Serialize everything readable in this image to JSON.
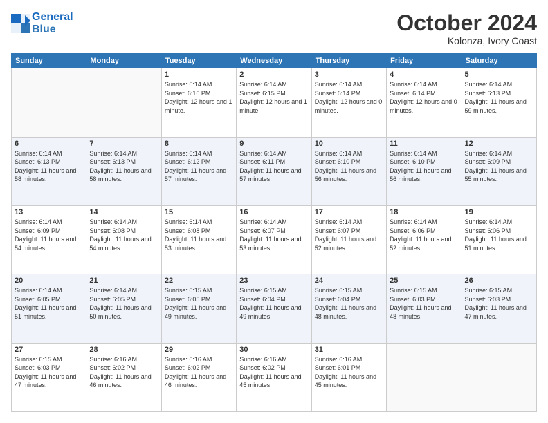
{
  "header": {
    "logo_line1": "General",
    "logo_line2": "Blue",
    "month": "October 2024",
    "location": "Kolonza, Ivory Coast"
  },
  "days_of_week": [
    "Sunday",
    "Monday",
    "Tuesday",
    "Wednesday",
    "Thursday",
    "Friday",
    "Saturday"
  ],
  "weeks": [
    [
      {
        "day": "",
        "info": ""
      },
      {
        "day": "",
        "info": ""
      },
      {
        "day": "1",
        "info": "Sunrise: 6:14 AM\nSunset: 6:16 PM\nDaylight: 12 hours and 1 minute."
      },
      {
        "day": "2",
        "info": "Sunrise: 6:14 AM\nSunset: 6:15 PM\nDaylight: 12 hours and 1 minute."
      },
      {
        "day": "3",
        "info": "Sunrise: 6:14 AM\nSunset: 6:14 PM\nDaylight: 12 hours and 0 minutes."
      },
      {
        "day": "4",
        "info": "Sunrise: 6:14 AM\nSunset: 6:14 PM\nDaylight: 12 hours and 0 minutes."
      },
      {
        "day": "5",
        "info": "Sunrise: 6:14 AM\nSunset: 6:13 PM\nDaylight: 11 hours and 59 minutes."
      }
    ],
    [
      {
        "day": "6",
        "info": "Sunrise: 6:14 AM\nSunset: 6:13 PM\nDaylight: 11 hours and 58 minutes."
      },
      {
        "day": "7",
        "info": "Sunrise: 6:14 AM\nSunset: 6:13 PM\nDaylight: 11 hours and 58 minutes."
      },
      {
        "day": "8",
        "info": "Sunrise: 6:14 AM\nSunset: 6:12 PM\nDaylight: 11 hours and 57 minutes."
      },
      {
        "day": "9",
        "info": "Sunrise: 6:14 AM\nSunset: 6:11 PM\nDaylight: 11 hours and 57 minutes."
      },
      {
        "day": "10",
        "info": "Sunrise: 6:14 AM\nSunset: 6:10 PM\nDaylight: 11 hours and 56 minutes."
      },
      {
        "day": "11",
        "info": "Sunrise: 6:14 AM\nSunset: 6:10 PM\nDaylight: 11 hours and 56 minutes."
      },
      {
        "day": "12",
        "info": "Sunrise: 6:14 AM\nSunset: 6:09 PM\nDaylight: 11 hours and 55 minutes."
      }
    ],
    [
      {
        "day": "13",
        "info": "Sunrise: 6:14 AM\nSunset: 6:09 PM\nDaylight: 11 hours and 54 minutes."
      },
      {
        "day": "14",
        "info": "Sunrise: 6:14 AM\nSunset: 6:08 PM\nDaylight: 11 hours and 54 minutes."
      },
      {
        "day": "15",
        "info": "Sunrise: 6:14 AM\nSunset: 6:08 PM\nDaylight: 11 hours and 53 minutes."
      },
      {
        "day": "16",
        "info": "Sunrise: 6:14 AM\nSunset: 6:07 PM\nDaylight: 11 hours and 53 minutes."
      },
      {
        "day": "17",
        "info": "Sunrise: 6:14 AM\nSunset: 6:07 PM\nDaylight: 11 hours and 52 minutes."
      },
      {
        "day": "18",
        "info": "Sunrise: 6:14 AM\nSunset: 6:06 PM\nDaylight: 11 hours and 52 minutes."
      },
      {
        "day": "19",
        "info": "Sunrise: 6:14 AM\nSunset: 6:06 PM\nDaylight: 11 hours and 51 minutes."
      }
    ],
    [
      {
        "day": "20",
        "info": "Sunrise: 6:14 AM\nSunset: 6:05 PM\nDaylight: 11 hours and 51 minutes."
      },
      {
        "day": "21",
        "info": "Sunrise: 6:14 AM\nSunset: 6:05 PM\nDaylight: 11 hours and 50 minutes."
      },
      {
        "day": "22",
        "info": "Sunrise: 6:15 AM\nSunset: 6:05 PM\nDaylight: 11 hours and 49 minutes."
      },
      {
        "day": "23",
        "info": "Sunrise: 6:15 AM\nSunset: 6:04 PM\nDaylight: 11 hours and 49 minutes."
      },
      {
        "day": "24",
        "info": "Sunrise: 6:15 AM\nSunset: 6:04 PM\nDaylight: 11 hours and 48 minutes."
      },
      {
        "day": "25",
        "info": "Sunrise: 6:15 AM\nSunset: 6:03 PM\nDaylight: 11 hours and 48 minutes."
      },
      {
        "day": "26",
        "info": "Sunrise: 6:15 AM\nSunset: 6:03 PM\nDaylight: 11 hours and 47 minutes."
      }
    ],
    [
      {
        "day": "27",
        "info": "Sunrise: 6:15 AM\nSunset: 6:03 PM\nDaylight: 11 hours and 47 minutes."
      },
      {
        "day": "28",
        "info": "Sunrise: 6:16 AM\nSunset: 6:02 PM\nDaylight: 11 hours and 46 minutes."
      },
      {
        "day": "29",
        "info": "Sunrise: 6:16 AM\nSunset: 6:02 PM\nDaylight: 11 hours and 46 minutes."
      },
      {
        "day": "30",
        "info": "Sunrise: 6:16 AM\nSunset: 6:02 PM\nDaylight: 11 hours and 45 minutes."
      },
      {
        "day": "31",
        "info": "Sunrise: 6:16 AM\nSunset: 6:01 PM\nDaylight: 11 hours and 45 minutes."
      },
      {
        "day": "",
        "info": ""
      },
      {
        "day": "",
        "info": ""
      }
    ]
  ]
}
